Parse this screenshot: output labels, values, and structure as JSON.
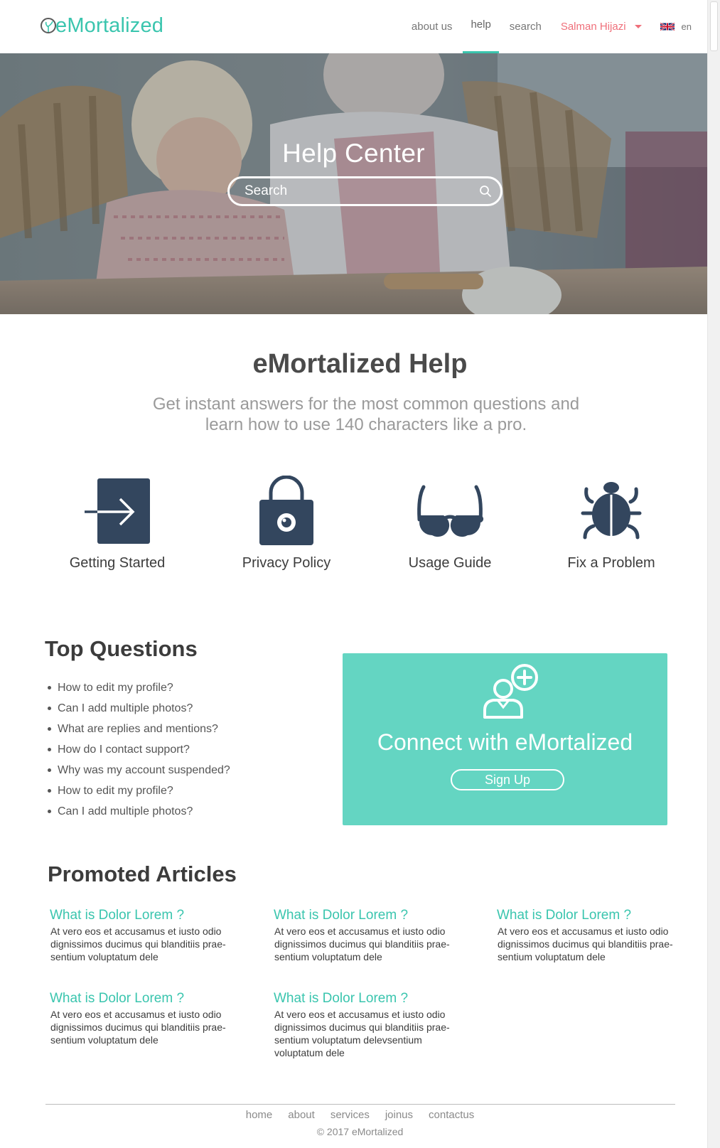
{
  "brand": {
    "name": "eMortalized",
    "color": "#3ac5ae"
  },
  "nav": {
    "items": [
      "about us",
      "help",
      "search"
    ],
    "active": "help",
    "user": "Salman Hijazi",
    "lang": "en"
  },
  "hero": {
    "title": "Help Center",
    "search_placeholder": "Search"
  },
  "intro": {
    "title": "eMortalized Help",
    "subtitle": "Get instant answers for the most common questions and learn how to use 140 characters like a pro."
  },
  "categories": [
    {
      "label": "Getting Started",
      "icon": "sign-in-icon"
    },
    {
      "label": "Privacy Policy",
      "icon": "padlock-icon"
    },
    {
      "label": "Usage Guide",
      "icon": "glasses-icon"
    },
    {
      "label": "Fix a Problem",
      "icon": "bug-icon"
    }
  ],
  "top_questions": {
    "title": "Top Questions",
    "items": [
      "How to edit my profile?",
      "Can I add multiple photos?",
      "What are replies and mentions?",
      "How do I contact support?",
      "Why was my account suspended?",
      "How to edit my profile?",
      "Can I add multiple photos?"
    ]
  },
  "connect": {
    "title": "Connect with eMortalized",
    "button": "Sign Up",
    "icon": "add-user-icon",
    "bg_color": "#64d5c2"
  },
  "promoted": {
    "title": "Promoted Articles",
    "articles": [
      {
        "title": "What is Dolor Lorem ?",
        "body": "At vero eos et accusamus et iusto odio dignissimos ducimus qui blanditiis prae- sentium voluptatum dele"
      },
      {
        "title": "What is Dolor Lorem ?",
        "body": "At vero eos et accusamus et iusto odio dignissimos ducimus qui blanditiis prae- sentium voluptatum dele"
      },
      {
        "title": "What is Dolor Lorem ?",
        "body": "At vero eos et accusamus et iusto odio dignissimos ducimus qui blanditiis prae- sentium voluptatum dele"
      },
      {
        "title": "What is Dolor Lorem ?",
        "body": "At vero eos et accusamus et iusto odio dignissimos ducimus qui blanditiis prae- sentium voluptatum dele"
      },
      {
        "title": "What is Dolor Lorem ?",
        "body": "At vero eos et accusamus et iusto odio dignissimos ducimus qui blanditiis prae- sentium voluptatum delevsentium voluptatum dele"
      }
    ]
  },
  "footer": {
    "links": [
      "home",
      "about",
      "services",
      "joinus",
      "contactus"
    ],
    "copyright": "2017 eMortalized"
  }
}
